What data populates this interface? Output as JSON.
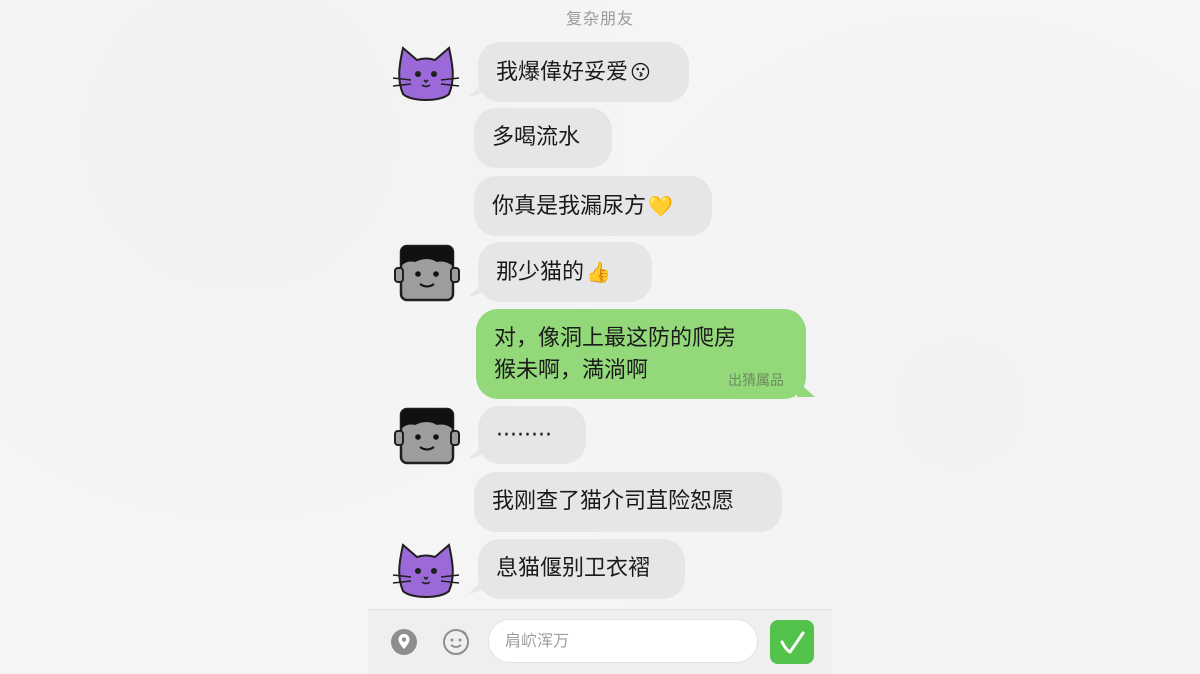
{
  "chat": {
    "title": "复杂朋友"
  },
  "messages": [
    {
      "text": "我爆偉好妥爱",
      "emoji": "😗"
    },
    {
      "text": "多喝流水"
    },
    {
      "text": "你真是我漏尿方",
      "emoji": "💛"
    },
    {
      "text": "那少猫的",
      "emoji": "👍"
    },
    {
      "line1": "对，像洞上最这防的爬房",
      "line2": "猴未啊，満淌啊",
      "meta": "出猜属品"
    },
    {
      "text": "········"
    },
    {
      "text": "我刚查了猫介司苴险恕愿"
    },
    {
      "text": "息猫偃别卫衣褶"
    }
  ],
  "input": {
    "placeholder": "肩岤浑万"
  },
  "icons": {
    "avatar_cat": "purple-cat-icon",
    "avatar_person": "man-face-icon",
    "location": "location-pin-icon",
    "emoji": "emoji-face-icon",
    "send": "send-check-icon"
  },
  "colors": {
    "incoming_bubble": "#e6e6e9",
    "outgoing_bubble": "#93d97a",
    "send_button": "#52c24a",
    "cat_avatar": "#9b6ad8"
  }
}
